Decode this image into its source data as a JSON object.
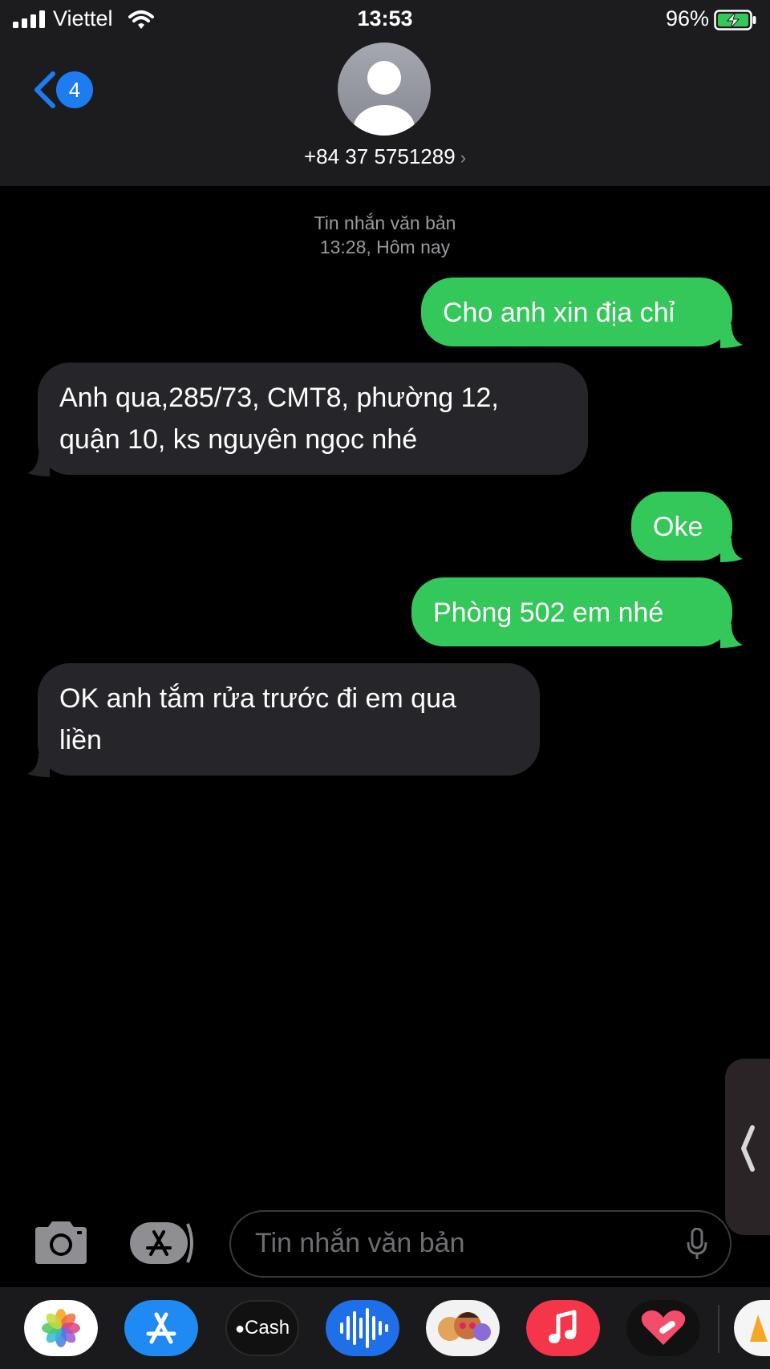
{
  "status_bar": {
    "carrier": "Viettel",
    "time": "13:53",
    "battery_percent": "96%"
  },
  "header": {
    "back_badge": "4",
    "contact": "+84 37 5751289",
    "contact_chevron": "›"
  },
  "conversation": {
    "service_label": "Tin nhắn văn bản",
    "timestamp": "13:28, Hôm nay",
    "messages": [
      {
        "direction": "sent",
        "text": "Cho anh xin địa chỉ"
      },
      {
        "direction": "received",
        "lines": [
          "Anh qua,285/73, CMT8, phường 12,",
          "quận 10, ks nguyên ngọc nhé"
        ]
      },
      {
        "direction": "sent",
        "text": "Oke"
      },
      {
        "direction": "sent",
        "text": "Phòng 502 em nhé"
      },
      {
        "direction": "received",
        "lines": [
          "OK anh tắm rửa trước đi em qua",
          "liền"
        ]
      }
    ]
  },
  "input": {
    "placeholder": "Tin nhắn văn bản"
  },
  "app_drawer": {
    "apps": [
      {
        "icon": "photos-icon"
      },
      {
        "icon": "app-store-icon"
      },
      {
        "icon": "apple-cash-icon",
        "label": "Cash"
      },
      {
        "icon": "audio-message-icon"
      },
      {
        "icon": "memoji-icon"
      },
      {
        "icon": "music-icon"
      },
      {
        "icon": "digital-touch-icon"
      }
    ]
  },
  "colors": {
    "sent_bubble": "#34c759",
    "received_bubble": "#26262a",
    "accent_blue": "#1e7cf2"
  }
}
